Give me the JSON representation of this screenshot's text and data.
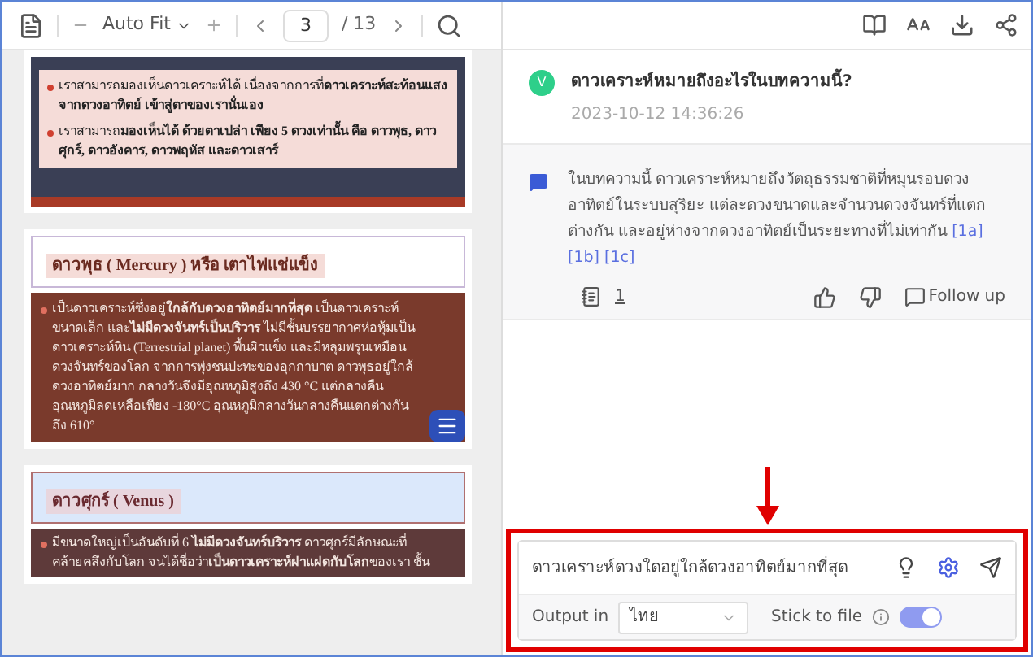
{
  "viewer_toolbar": {
    "zoom": "Auto Fit",
    "page": "3",
    "total": "/ 13"
  },
  "pages": [
    {
      "kind": "bullets",
      "bullets": [
        "เราสามารถมองเห็นดาวเคราะห์ได้ เนื่องจากการที่**ดาวเคราะห์สะท้อนแสงจากดวงอาทิตย์ เข้าสู่ตาของเรานั่นเอง**",
        "เราสามารถ**มองเห็นได้ ด้วยตาเปล่า เพียง 5 ดวงเท่านั้น คือ ดาวพุธ, ดาวศุกร์, ดาวอังคาร, ดาวพฤหัส และดาวเสาร์**"
      ]
    },
    {
      "kind": "titled",
      "title": "ดาวพุธ ( Mercury ) หรือ เตาไฟแช่แข็ง",
      "body": "เป็นดาวเคราะห์ซึ่งอยู่**ใกล้กับดวงอาทิตย์มากที่สุด** เป็นดาวเคราะห์ขนาดเล็ก และ**ไม่มีดวงจันทร์เป็นบริวาร** ไม่มีชั้นบรรยากาศห่อหุ้มเป็นดาวเคราะห์หิน (Terrestrial planet) พื้นผิวแข็ง และมีหลุมพรุนเหมือนดวงจันทร์ของโลก จากการพุ่งชนปะทะของอุกกาบาต ดาวพุธอยู่ใกล้ดวงอาทิตย์มาก กลางวันจึงมีอุณหภูมิสูงถึง 430 °C แต่กลางคืนอุณหภูมิลดเหลือเพียง -180°C อุณหภูมิกลางวันกลางคืนแตกต่างกันถึง 610°",
      "chat_badge": true
    },
    {
      "kind": "titled",
      "title": "ดาวศุกร์ ( Venus )",
      "body": "มีขนาดใหญ่เป็นอันดับที่ 6 **ไม่มีดวงจันทร์บริวาร** ดาวศุกร์มีลักษณะที่คล้ายคลึงกับโลก จนได้ชื่อว่า**เป็นดาวเคราะห์ฝาแฝดกับโลก**ของเรา ชั้น",
      "chat_badge": false
    }
  ],
  "question": {
    "avatar": "V",
    "text": "ดาวเคราะห์หมายถึงอะไรในบทความนี้?",
    "time": "2023-10-12 14:36:26"
  },
  "answer": {
    "text": "ในบทความนี้ ดาวเคราะห์หมายถึงวัตถุธรรมชาติที่หมุนรอบดวงอาทิตย์ในระบบสุริยะ แต่ละดวงขนาดและจำนวนดวงจันทร์ที่แตกต่างกัน และอยู่ห่างจากดวงอาทิตย์เป็นระยะทางที่ไม่เท่ากัน",
    "citations": [
      "[1a]",
      "[1b]",
      "[1c]"
    ],
    "source_count": "1",
    "follow_up": "Follow up"
  },
  "composer": {
    "value": "ดาวเคราะห์ดวงใดอยู่ใกล้ดวงอาทิตย์มากที่สุด",
    "output_label": "Output in",
    "language": "ไทย",
    "stick_label": "Stick to file",
    "stick_on": true
  }
}
